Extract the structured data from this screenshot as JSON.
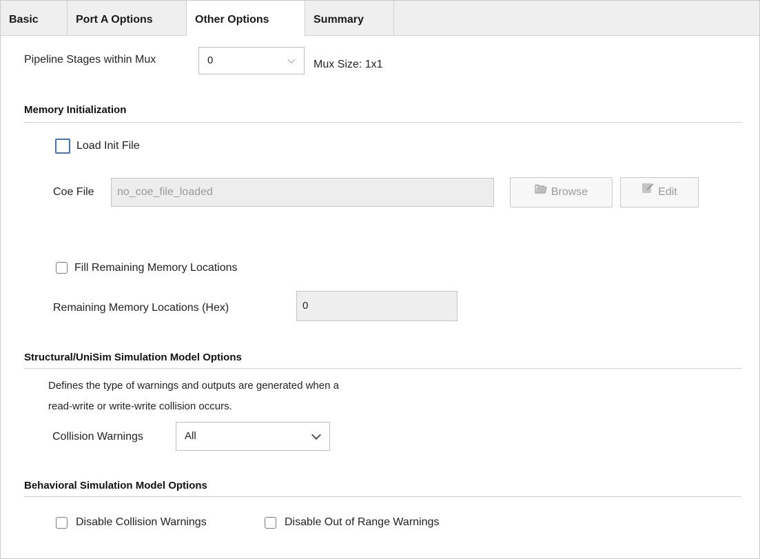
{
  "tabs": [
    {
      "label": "Basic",
      "active": false
    },
    {
      "label": "Port A Options",
      "active": false
    },
    {
      "label": "Other Options",
      "active": true
    },
    {
      "label": "Summary",
      "active": false
    }
  ],
  "pipeline": {
    "label": "Pipeline Stages within Mux",
    "value": "0",
    "mux_size": "Mux Size: 1x1"
  },
  "memory_init": {
    "title": "Memory Initialization",
    "load_init_label": "Load Init File",
    "load_init_checked": false,
    "coe_label": "Coe File",
    "coe_value": "no_coe_file_loaded",
    "browse_label": "Browse",
    "edit_label": "Edit",
    "fill_label": "Fill Remaining Memory Locations",
    "fill_checked": false,
    "remaining_label": "Remaining Memory Locations (Hex)",
    "remaining_value": "0"
  },
  "structural": {
    "title": "Structural/UniSim Simulation Model Options",
    "desc_line1": "Defines the type of warnings and outputs are generated when a",
    "desc_line2": "read-write or write-write collision occurs.",
    "collision_label": "Collision Warnings",
    "collision_value": "All"
  },
  "behavioral": {
    "title": "Behavioral Simulation Model Options",
    "disable_collision_label": "Disable Collision Warnings",
    "disable_collision_checked": false,
    "disable_range_label": "Disable Out of Range Warnings",
    "disable_range_checked": false
  },
  "colors": {
    "tab_bar": "#efefef",
    "focus_blue": "#3f73c9",
    "disabled_text": "#9a9a9a"
  }
}
